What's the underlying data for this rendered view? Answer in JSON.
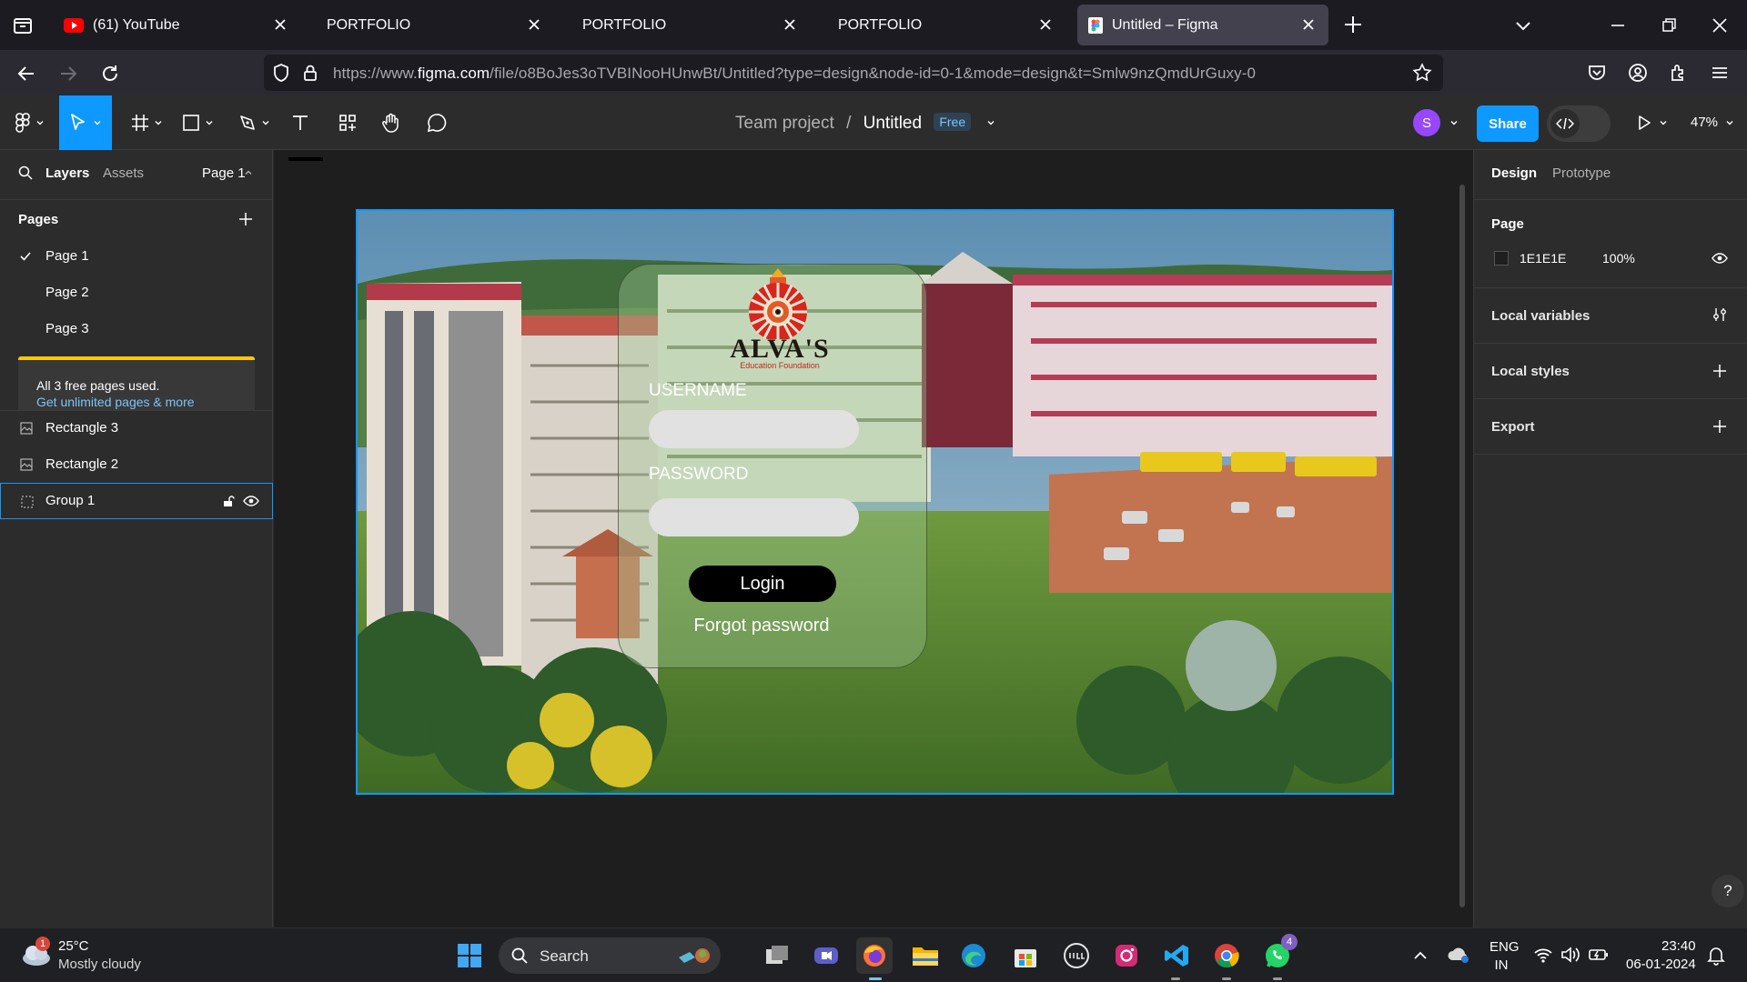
{
  "browser": {
    "tabs": [
      {
        "label": "(61) YouTube",
        "icon": "youtube-icon",
        "active": false
      },
      {
        "label": "PORTFOLIO",
        "icon": "",
        "active": false
      },
      {
        "label": "PORTFOLIO",
        "icon": "",
        "active": false
      },
      {
        "label": "PORTFOLIO",
        "icon": "",
        "active": false
      },
      {
        "label": "Untitled – Figma",
        "icon": "figma-icon",
        "active": true
      }
    ],
    "url_prefix": "https://www.",
    "url_host": "figma.com",
    "url_path": "/file/o8BoJes3oTVBINooHUnwBt/Untitled?type=design&node-id=0-1&mode=design&t=Smlw9nzQmdUrGuxy-0"
  },
  "figma": {
    "team": "Team project",
    "separator": "/",
    "file_name": "Untitled",
    "plan_badge": "Free",
    "avatar_initial": "S",
    "share_label": "Share",
    "zoom": "47%",
    "left_tabs": {
      "layers": "Layers",
      "assets": "Assets",
      "page_selector": "Page 1"
    },
    "pages_heading": "Pages",
    "pages": [
      "Page 1",
      "Page 2",
      "Page 3"
    ],
    "upgrade_note": "All 3 free pages used.",
    "upgrade_link": "Get unlimited pages & more",
    "layers": [
      "Rectangle 3",
      "Rectangle 2",
      "Group 1"
    ],
    "right_tabs": {
      "design": "Design",
      "prototype": "Prototype"
    },
    "page_section": {
      "heading": "Page",
      "color_hex": "1E1E1E",
      "opacity": "100%"
    },
    "sections": [
      "Local variables",
      "Local styles",
      "Export"
    ],
    "help": "?"
  },
  "design": {
    "logo_text": "ALVA'S",
    "logo_subtitle": "Education Foundation",
    "username_label": "USERNAME",
    "password_label": "PASSWORD",
    "login_label": "Login",
    "forgot_label": "Forgot password"
  },
  "taskbar": {
    "temperature": "25°C",
    "weather": "Mostly cloudy",
    "weather_badge": "1",
    "search": "Search",
    "lang_top": "ENG",
    "lang_bottom": "IN",
    "time": "23:40",
    "date": "06-01-2024",
    "whatsapp_badge": "4"
  },
  "colors": {
    "accent": "#0d99ff",
    "figma_dark": "#2c2c2c",
    "canvas": "#1e1e1e",
    "warning": "#ffc700",
    "avatar": "#9747ff"
  }
}
